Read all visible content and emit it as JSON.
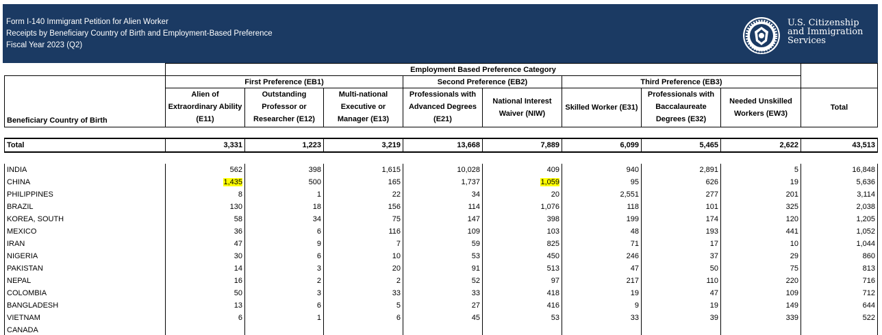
{
  "header": {
    "line1": "Form I-140 Immigrant Petition for Alien Worker",
    "line2": "Receipts by Beneficiary Country of Birth and Employment-Based Preference",
    "line3": "Fiscal Year 2023 (Q2)",
    "agency": [
      "U.S. Citizenship",
      "and Immigration",
      "Services"
    ],
    "seal_icon": "dhs-seal-icon",
    "banner_color": "#1b3a63"
  },
  "table": {
    "category_header": "Employment Based Preference Category",
    "groups": [
      "First Preference (EB1)",
      "Second Preference (EB2)",
      "Third Preference (EB3)"
    ],
    "row_label_header": "Beneficiary Country of Birth",
    "columns": [
      "Alien of Extraordinary Ability (E11)",
      "Outstanding Professor or Researcher (E12)",
      "Multi-national Executive or Manager (E13)",
      "Professionals with Advanced Degrees (E21)",
      "National Interest Waiver (NIW)",
      "Skilled Worker (E31)",
      "Professionals with Baccalaureate Degrees (E32)",
      "Needed Unskilled Workers (EW3)",
      "Total"
    ],
    "total_row": {
      "label": "Total",
      "values": [
        "3,331",
        "1,223",
        "3,219",
        "13,668",
        "7,889",
        "6,099",
        "5,465",
        "2,622",
        "43,513"
      ]
    },
    "rows": [
      {
        "country": "INDIA",
        "values": [
          "562",
          "398",
          "1,615",
          "10,028",
          "409",
          "940",
          "2,891",
          "5",
          "16,848"
        ]
      },
      {
        "country": "CHINA",
        "values": [
          "1,435",
          "500",
          "165",
          "1,737",
          "1,059",
          "95",
          "626",
          "19",
          "5,636"
        ]
      },
      {
        "country": "PHILIPPINES",
        "values": [
          "8",
          "1",
          "22",
          "34",
          "20",
          "2,551",
          "277",
          "201",
          "3,114"
        ]
      },
      {
        "country": "BRAZIL",
        "values": [
          "130",
          "18",
          "156",
          "114",
          "1,076",
          "118",
          "101",
          "325",
          "2,038"
        ]
      },
      {
        "country": "KOREA, SOUTH",
        "values": [
          "58",
          "34",
          "75",
          "147",
          "398",
          "199",
          "174",
          "120",
          "1,205"
        ]
      },
      {
        "country": "MEXICO",
        "values": [
          "36",
          "6",
          "116",
          "109",
          "103",
          "48",
          "193",
          "441",
          "1,052"
        ]
      },
      {
        "country": "IRAN",
        "values": [
          "47",
          "9",
          "7",
          "59",
          "825",
          "71",
          "17",
          "10",
          "1,044"
        ]
      },
      {
        "country": "NIGERIA",
        "values": [
          "30",
          "6",
          "10",
          "53",
          "450",
          "246",
          "37",
          "29",
          "860"
        ]
      },
      {
        "country": "PAKISTAN",
        "values": [
          "14",
          "3",
          "20",
          "91",
          "513",
          "47",
          "50",
          "75",
          "813"
        ]
      },
      {
        "country": "NEPAL",
        "values": [
          "16",
          "2",
          "2",
          "52",
          "97",
          "217",
          "110",
          "220",
          "716"
        ]
      },
      {
        "country": "COLOMBIA",
        "values": [
          "50",
          "3",
          "33",
          "33",
          "418",
          "19",
          "47",
          "109",
          "712"
        ]
      },
      {
        "country": "BANGLADESH",
        "values": [
          "13",
          "6",
          "5",
          "27",
          "416",
          "9",
          "19",
          "149",
          "644"
        ]
      },
      {
        "country": "VIETNAM",
        "values": [
          "6",
          "1",
          "6",
          "45",
          "53",
          "33",
          "39",
          "339",
          "522"
        ]
      }
    ],
    "highlight_color": "#ffff00"
  }
}
